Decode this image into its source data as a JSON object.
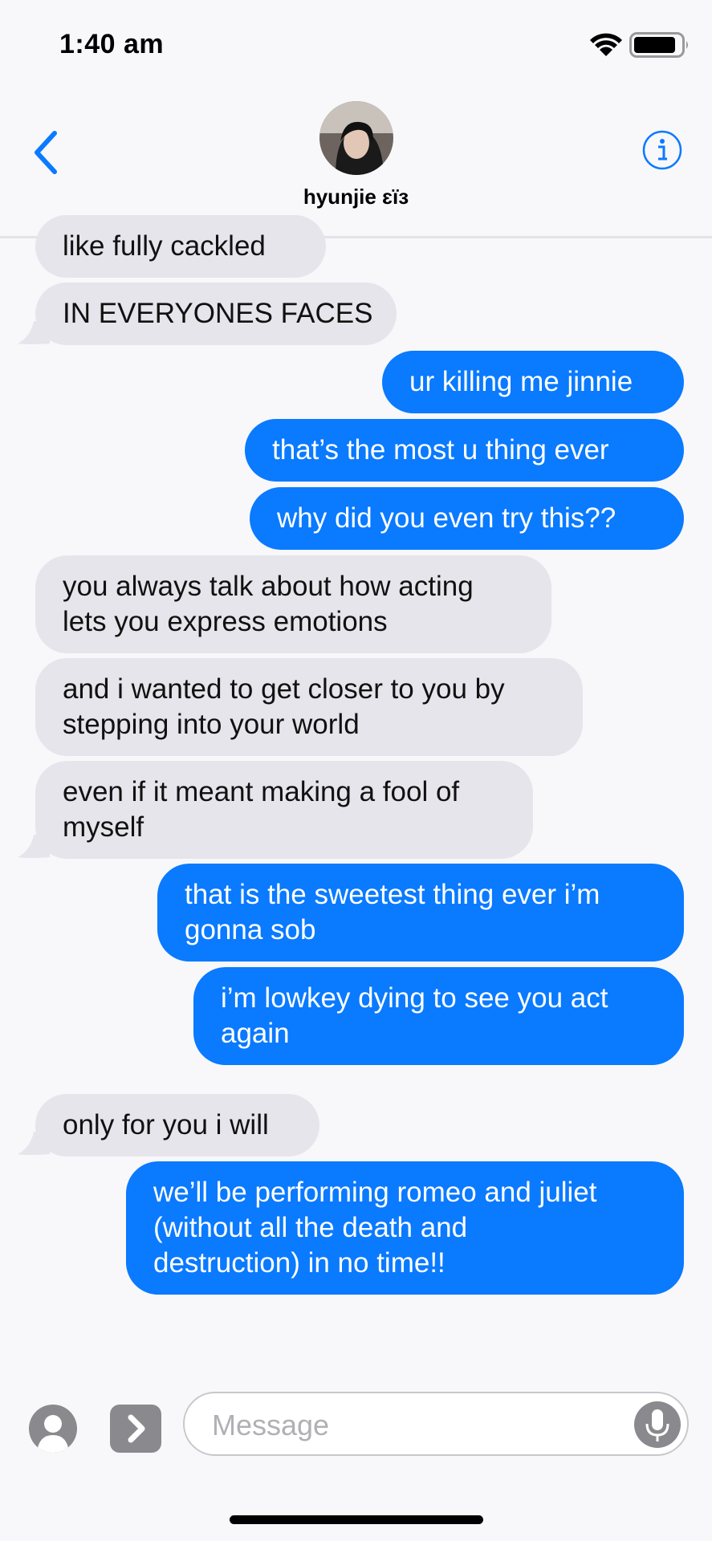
{
  "status": {
    "time": "1:40 am"
  },
  "header": {
    "contact_name": "hyunjie ɛïɜ"
  },
  "messages": [
    {
      "from": "them",
      "text": "like fully cackled"
    },
    {
      "from": "them",
      "text": "IN EVERYONES FACES"
    },
    {
      "from": "me",
      "text": "ur killing me jinnie"
    },
    {
      "from": "me",
      "text": "that’s the most u thing ever"
    },
    {
      "from": "me",
      "text": "why did you even try this??"
    },
    {
      "from": "them",
      "lines": [
        "you always talk about how acting",
        "lets you express emotions"
      ]
    },
    {
      "from": "them",
      "lines": [
        "and i wanted to get closer to you by",
        "stepping into your world"
      ]
    },
    {
      "from": "them",
      "lines": [
        "even if it meant making a fool of",
        "myself"
      ]
    },
    {
      "from": "me",
      "lines": [
        "that is the sweetest thing ever i’m",
        "gonna sob"
      ]
    },
    {
      "from": "me",
      "lines": [
        "i’m lowkey dying to see you act",
        "again"
      ]
    },
    {
      "from": "them",
      "text": "only for you i will"
    },
    {
      "from": "me",
      "lines": [
        "we’ll be performing romeo and juliet",
        "(without all the death and",
        "destruction) in no time!!"
      ]
    }
  ],
  "composer": {
    "placeholder": "Message"
  },
  "colors": {
    "accent": "#0a7aff",
    "incoming_bubble": "#e6e5eb",
    "background": "#f8f8fa"
  },
  "icons": [
    "wifi-icon",
    "battery-icon",
    "back-chevron-icon",
    "info-icon",
    "apps-icon",
    "app-store-chevron-icon",
    "microphone-icon"
  ]
}
